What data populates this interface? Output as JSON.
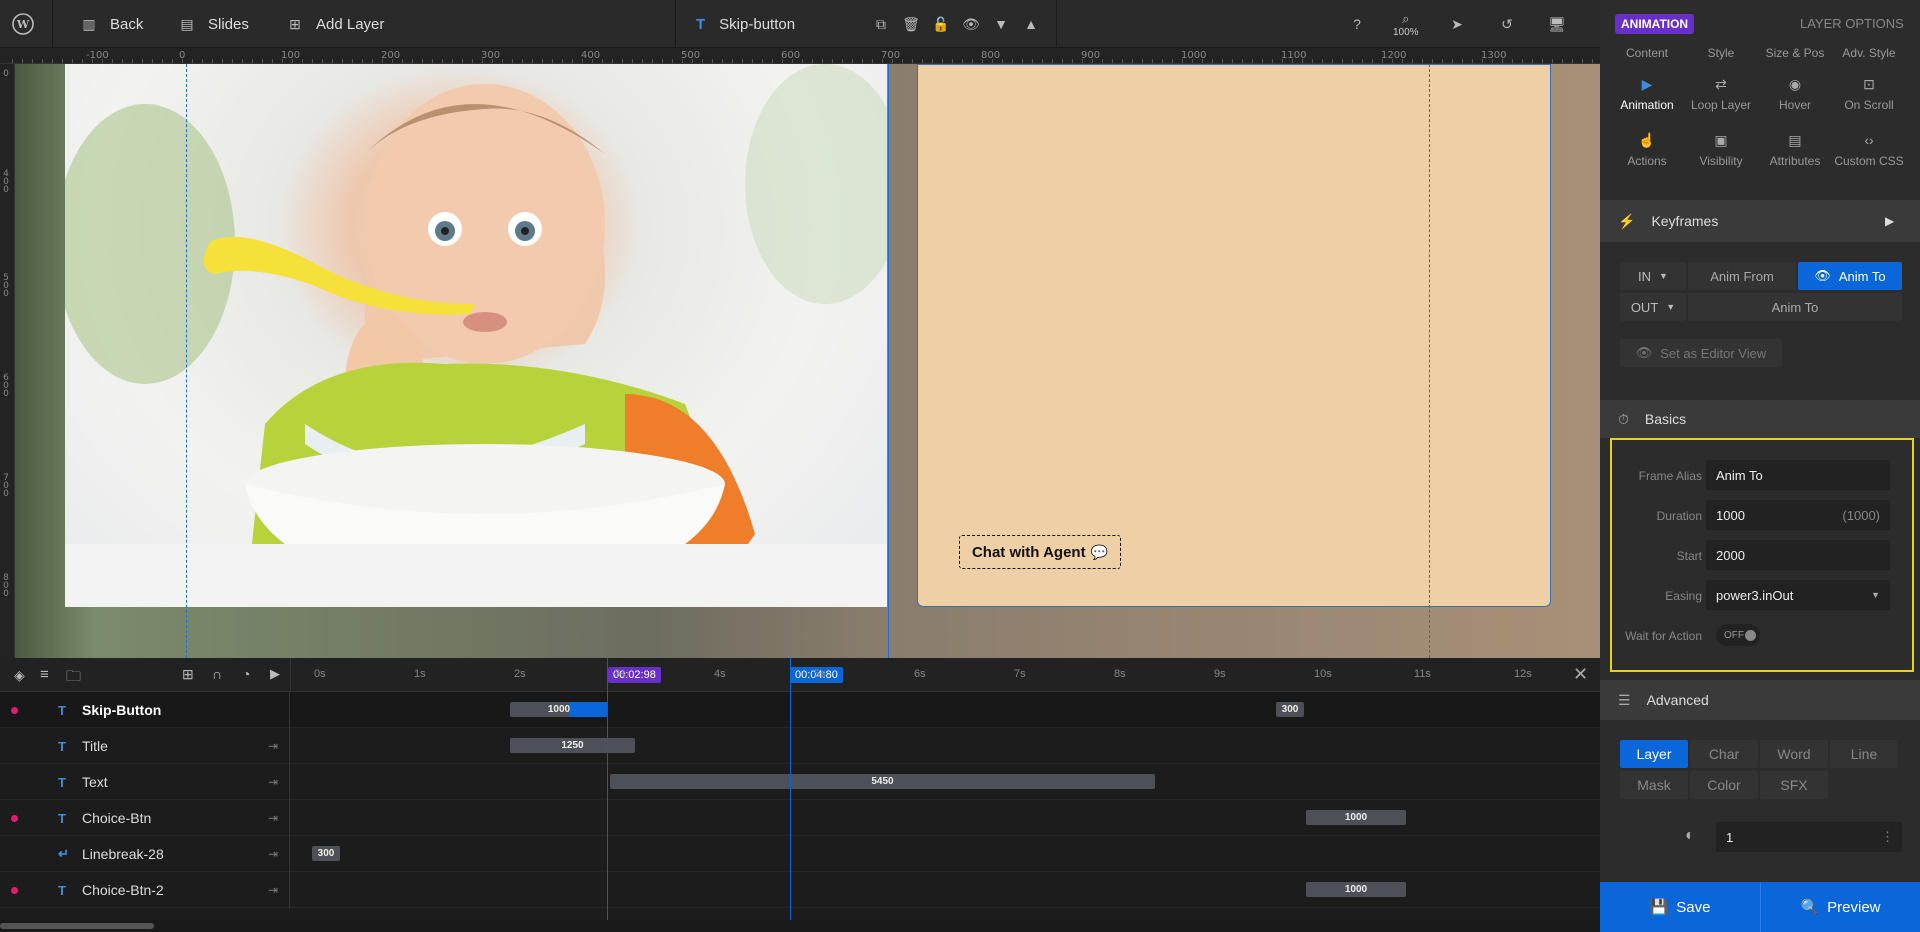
{
  "toolbar": {
    "back": "Back",
    "slides": "Slides",
    "add_layer": "Add Layer",
    "layer_name": "Skip-button",
    "zoom": "100%"
  },
  "ruler": {
    "h": [
      "-100",
      "0",
      "100",
      "200",
      "300",
      "400",
      "500",
      "600",
      "700",
      "800",
      "900",
      "1000",
      "1100",
      "1200",
      "1300"
    ],
    "v": [
      "0",
      "400",
      "500",
      "600",
      "700",
      "800"
    ]
  },
  "canvas": {
    "chat_button": "Chat with Agent"
  },
  "timeline": {
    "ticks": [
      "0s",
      "1s",
      "2s",
      "3s",
      "4s",
      "5s",
      "6s",
      "7s",
      "8s",
      "9s",
      "10s",
      "11s",
      "12s"
    ],
    "badge_current": "00:02:98",
    "badge_end": "00:04:80",
    "rows": [
      {
        "name": "Skip-Button",
        "type": "T",
        "dot": true,
        "bars": [
          "1000",
          "300"
        ]
      },
      {
        "name": "Title",
        "type": "T",
        "dot": false,
        "bars": [
          "1250"
        ]
      },
      {
        "name": "Text",
        "type": "T",
        "dot": false,
        "bars": [
          "5450"
        ]
      },
      {
        "name": "Choice-Btn",
        "type": "T",
        "dot": true,
        "bars": [
          "1000"
        ]
      },
      {
        "name": "Linebreak-28",
        "type": "↵",
        "dot": false,
        "bars": [
          "300"
        ]
      },
      {
        "name": "Choice-Btn-2",
        "type": "T",
        "dot": true,
        "bars": [
          "1000"
        ]
      }
    ]
  },
  "panel": {
    "badge": "ANIMATION",
    "layer_options": "LAYER OPTIONS",
    "tabs_top": [
      "Content",
      "Style",
      "Size & Pos",
      "Adv. Style"
    ],
    "tabs_mid": [
      "Animation",
      "Loop Layer",
      "Hover",
      "On Scroll"
    ],
    "tabs_bot": [
      "Actions",
      "Visibility",
      "Attributes",
      "Custom CSS"
    ],
    "keyframes": "Keyframes",
    "in_label": "IN",
    "out_label": "OUT",
    "anim_from": "Anim From",
    "anim_to": "Anim To",
    "anim_to_out": "Anim To",
    "set_editor_view": "Set as Editor View",
    "basics": "Basics",
    "frame_alias_label": "Frame Alias",
    "frame_alias": "Anim To",
    "duration_label": "Duration",
    "duration": "1000",
    "duration_hint": "(1000)",
    "start_label": "Start",
    "start": "2000",
    "easing_label": "Easing",
    "easing": "power3.inOut",
    "wait_label": "Wait for Action",
    "wait_value": "OFF",
    "advanced": "Advanced",
    "adv_tabs": [
      "Layer",
      "Char",
      "Word",
      "Line"
    ],
    "adv_tabs2": [
      "Mask",
      "Color",
      "SFX"
    ],
    "opacity_value": "1",
    "save": "Save",
    "preview": "Preview"
  },
  "colors": {
    "accent": "#0a66d9",
    "badge": "#6a2fc9",
    "highlight": "#e6d21a",
    "dot": "#e7196f"
  }
}
